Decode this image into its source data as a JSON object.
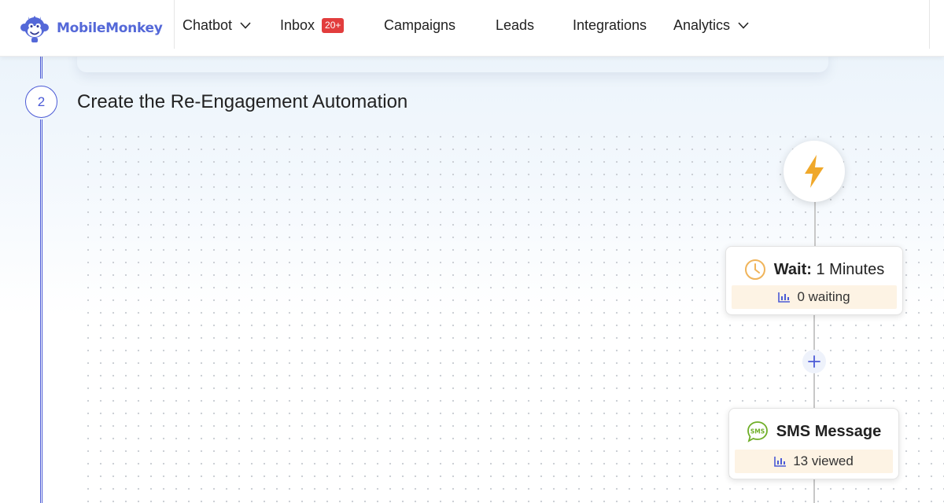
{
  "brand": {
    "name": "MobileMonkey",
    "icon": "monkey-logo-icon",
    "color": "#5468d8"
  },
  "nav": {
    "chatbot": "Chatbot",
    "inbox": "Inbox",
    "inbox_badge": "20+",
    "campaigns": "Campaigns",
    "leads": "Leads",
    "integrations": "Integrations",
    "analytics": "Analytics"
  },
  "step": {
    "number": "2",
    "title": "Create the Re-Engagement Automation"
  },
  "flow": {
    "trigger": {
      "icon": "lightning-bolt-icon",
      "color": "#f0a82a"
    },
    "wait": {
      "label": "Wait:",
      "value": "1 Minutes",
      "stat": "0 waiting",
      "icon": "clock-icon"
    },
    "add_step": {
      "icon": "plus-icon"
    },
    "sms": {
      "label": "SMS Message",
      "stat": "13 viewed",
      "icon": "sms-bubble-icon"
    }
  },
  "colors": {
    "accent": "#4b5ad6",
    "badge": "#e23d3d",
    "stat_bg": "#fdf3e4",
    "sms_green": "#6fae27"
  }
}
